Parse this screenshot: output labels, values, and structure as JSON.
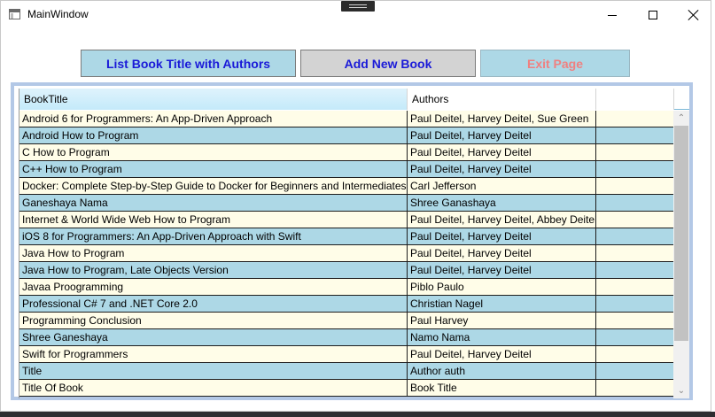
{
  "window": {
    "title": "MainWindow",
    "icons": [
      "app-icon",
      "minimize-icon",
      "maximize-icon",
      "close-icon"
    ]
  },
  "toolbar": {
    "list_label": "List Book Title with Authors",
    "add_label": "Add New Book",
    "exit_label": "Exit Page",
    "colors": {
      "list_bg": "#add8e6",
      "add_bg": "#d3d3d3",
      "exit_bg": "#add8e6",
      "primary_text": "#1a1ad8",
      "exit_text": "#f08080"
    }
  },
  "grid": {
    "columns": [
      "BookTitle",
      "Authors"
    ],
    "colors": {
      "odd_row": "#fffde8",
      "even_row": "#add8e6",
      "frame": "#b3c8e6"
    },
    "rows": [
      {
        "title": "Android 6 for Programmers: An App-Driven Approach",
        "authors": "Paul Deitel, Harvey Deitel, Sue Green"
      },
      {
        "title": "Android How to Program",
        "authors": "Paul Deitel, Harvey Deitel"
      },
      {
        "title": "C How to Program",
        "authors": "Paul Deitel, Harvey Deitel"
      },
      {
        "title": "C++ How to Program",
        "authors": "Paul Deitel, Harvey Deitel"
      },
      {
        "title": "Docker: Complete Step-by-Step Guide to Docker for Beginners and Intermediates",
        "authors": "Carl Jefferson"
      },
      {
        "title": "Ganeshaya Nama",
        "authors": "Shree Ganashaya"
      },
      {
        "title": "Internet & World Wide Web How to Program",
        "authors": "Paul Deitel, Harvey Deitel, Abbey Deitel"
      },
      {
        "title": "iOS 8 for Programmers: An App-Driven Approach with Swift",
        "authors": "Paul Deitel, Harvey Deitel"
      },
      {
        "title": "Java How to Program",
        "authors": "Paul Deitel, Harvey Deitel"
      },
      {
        "title": "Java How to Program, Late Objects Version",
        "authors": "Paul Deitel, Harvey Deitel"
      },
      {
        "title": "Javaa Proogramming",
        "authors": "Piblo Paulo"
      },
      {
        "title": "Professional C# 7 and .NET Core 2.0",
        "authors": "Christian Nagel"
      },
      {
        "title": "Programming Conclusion",
        "authors": "Paul Harvey"
      },
      {
        "title": "Shree Ganeshaya",
        "authors": "Namo Nama"
      },
      {
        "title": "Swift for Programmers",
        "authors": "Paul Deitel, Harvey Deitel"
      },
      {
        "title": "Title",
        "authors": "Author auth"
      },
      {
        "title": "Title Of Book",
        "authors": "Book Title"
      }
    ]
  }
}
